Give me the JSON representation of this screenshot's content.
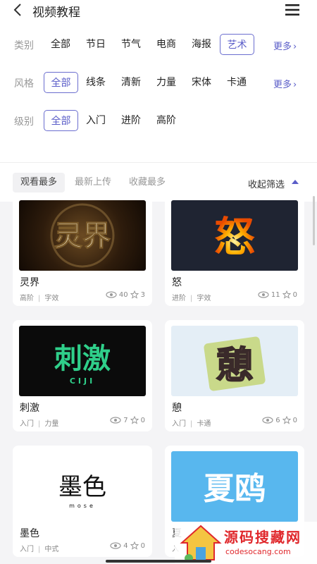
{
  "header": {
    "title": "视频教程",
    "back_icon": "chevron-left-icon",
    "menu_icon": "menu-icon"
  },
  "filters": {
    "category": {
      "label": "类别",
      "options": [
        "全部",
        "节日",
        "节气",
        "电商",
        "海报",
        "艺术"
      ],
      "selected": "艺术",
      "more": "更多"
    },
    "style": {
      "label": "风格",
      "options": [
        "全部",
        "线条",
        "清新",
        "力量",
        "宋体",
        "卡通"
      ],
      "selected": "全部",
      "more": "更多"
    },
    "level": {
      "label": "级别",
      "options": [
        "全部",
        "入门",
        "进阶",
        "高阶"
      ],
      "selected": "全部"
    }
  },
  "sort": {
    "tabs": [
      "观看最多",
      "最新上传",
      "收藏最多"
    ],
    "active": "观看最多",
    "collapse": "收起筛选"
  },
  "accent_color": "#5a5dc8",
  "cards": [
    {
      "title": "灵界",
      "level": "高阶",
      "tag": "字效",
      "views": "40",
      "favorites": "3",
      "thumb_text": "灵界"
    },
    {
      "title": "怒",
      "level": "进阶",
      "tag": "字效",
      "views": "11",
      "favorites": "0",
      "thumb_text": "怒"
    },
    {
      "title": "刺激",
      "level": "入门",
      "tag": "力量",
      "views": "7",
      "favorites": "0",
      "thumb_text": "刺激",
      "thumb_sub": "CIJI"
    },
    {
      "title": "憩",
      "level": "入门",
      "tag": "卡通",
      "views": "6",
      "favorites": "0",
      "thumb_text": "憩"
    },
    {
      "title": "墨色",
      "level": "入门",
      "tag": "中式",
      "views": "4",
      "favorites": "0",
      "thumb_text": "墨色",
      "thumb_sub": "mose"
    },
    {
      "title": "夏",
      "level": "入",
      "tag": "",
      "views": "",
      "favorites": "",
      "thumb_text": "夏鸥"
    }
  ],
  "watermark": {
    "text": "源码搜藏网",
    "sub": "codesocang.com"
  }
}
